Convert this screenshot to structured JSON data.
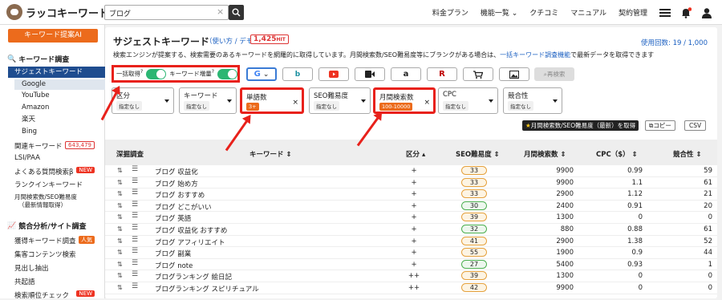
{
  "header": {
    "logo_text": "ラッコキーワード",
    "search_value": "ブログ",
    "clear_icon": "×",
    "nav": [
      "料金プラン",
      "機能一覧 ⌄",
      "クチコミ",
      "マニュアル",
      "契約管理"
    ]
  },
  "sidebar": {
    "kw_button": "キーワード提案AI",
    "section1": "キーワード調査",
    "active": "サジェストキーワード",
    "engines": [
      "Google",
      "YouTube",
      "Amazon",
      "楽天",
      "Bing"
    ],
    "related": "関連キーワード",
    "related_count": "643,479",
    "items1": [
      "LSI/PAA",
      "よくある質問検索β",
      "ランクインキーワード",
      "月間検索数/SEO難易度",
      "（最新情報取得）"
    ],
    "new_badge": "NEW",
    "section2": "競合分析/サイト調査",
    "items2": [
      "獲得キーワード調査",
      "集客コンテンツ検索",
      "見出し抽出",
      "共起語",
      "検索順位チェック"
    ],
    "pop_badge": "人気"
  },
  "page": {
    "title": "サジェストキーワード",
    "help": "（使い方 / デモ）",
    "count": "1,425",
    "count_sub": "HIT",
    "usage": "使用回数: 19 / 1,000",
    "desc_pre": "検索エンジンが提案する、検索需要のあるキーワードを網羅的に取得しています。月間検索数/SEO難易度等にブランクがある場合は、",
    "desc_link": "一括キーワード調査機能",
    "desc_post": "で最新データを取得できます"
  },
  "toggles": {
    "bulk": "一括取得",
    "add": "キーワード増量"
  },
  "rebtn": "再検索",
  "filters": [
    {
      "label": "区分",
      "value": "指定なし"
    },
    {
      "label": "キーワード",
      "value": "指定なし"
    },
    {
      "label": "単語数",
      "value": "3+"
    },
    {
      "label": "SEO難易度",
      "value": "指定なし"
    },
    {
      "label": "月間検索数",
      "value": "100-10000"
    },
    {
      "label": "CPC",
      "value": "指定なし"
    },
    {
      "label": "競合性",
      "value": "指定なし"
    }
  ],
  "actions": {
    "export": "月間検索数/SEO難易度（最新）を取得",
    "copy": "コピー",
    "csv": "CSV"
  },
  "columns": {
    "deep": "深掘調査",
    "keyword": "キーワード",
    "kubun": "区分",
    "seo": "SEO難易度",
    "vol": "月間検索数",
    "cpc": "CPC（$）",
    "comp": "競合性"
  },
  "rows": [
    {
      "kw": "ブログ 収益化",
      "c": "+",
      "seo": "33",
      "g": false,
      "vol": "9900",
      "cpc": "0.99",
      "cmp": "59"
    },
    {
      "kw": "ブログ 始め方",
      "c": "+",
      "seo": "33",
      "g": false,
      "vol": "9900",
      "cpc": "1.1",
      "cmp": "61"
    },
    {
      "kw": "ブログ おすすめ",
      "c": "+",
      "seo": "33",
      "g": false,
      "vol": "2900",
      "cpc": "1.12",
      "cmp": "21"
    },
    {
      "kw": "ブログ どこがいい",
      "c": "+",
      "seo": "30",
      "g": true,
      "vol": "2400",
      "cpc": "0.91",
      "cmp": "20"
    },
    {
      "kw": "ブログ 英語",
      "c": "+",
      "seo": "39",
      "g": false,
      "vol": "1300",
      "cpc": "0",
      "cmp": "0"
    },
    {
      "kw": "ブログ 収益化 おすすめ",
      "c": "+",
      "seo": "32",
      "g": true,
      "vol": "880",
      "cpc": "0.88",
      "cmp": "61"
    },
    {
      "kw": "ブログ アフィリエイト",
      "c": "+",
      "seo": "41",
      "g": false,
      "vol": "2900",
      "cpc": "1.38",
      "cmp": "52"
    },
    {
      "kw": "ブログ 副業",
      "c": "+",
      "seo": "55",
      "g": false,
      "vol": "1900",
      "cpc": "0.9",
      "cmp": "44"
    },
    {
      "kw": "ブログ note",
      "c": "+",
      "seo": "27",
      "g": true,
      "vol": "5400",
      "cpc": "0.93",
      "cmp": "1"
    },
    {
      "kw": "ブログランキング 絵日記",
      "c": "++",
      "seo": "39",
      "g": false,
      "vol": "1300",
      "cpc": "0",
      "cmp": "0"
    },
    {
      "kw": "ブログランキング スピリチュアル",
      "c": "++",
      "seo": "42",
      "g": false,
      "vol": "9900",
      "cpc": "0",
      "cmp": "0"
    }
  ]
}
